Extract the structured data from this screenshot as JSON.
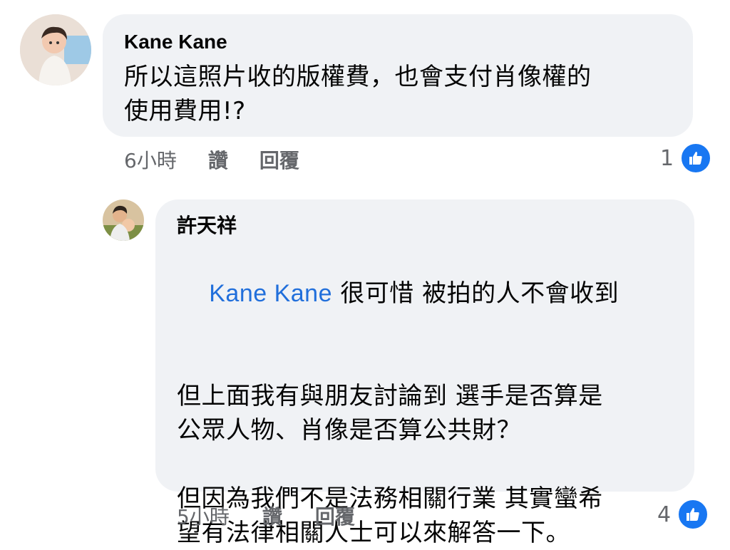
{
  "comments": [
    {
      "author": "Kane Kane",
      "text": "所以這照片收的版權費，也會支付肖像權的\n使用費用!?",
      "time": "6小時",
      "like_label": "讚",
      "reply_label": "回覆",
      "reaction_count": "1",
      "reaction_icon": "thumbs-up-icon"
    }
  ],
  "reply": {
    "author": "許天祥",
    "mention": "Kane Kane",
    "line1_rest": " 很可惜 被拍的人不會收到",
    "paragraph2": "但上面我有與朋友討論到 選手是否算是\n公眾人物、肖像是否算公共財？",
    "paragraph3": "但因為我們不是法務相關行業 其實蠻希\n望有法律相關人士可以來解答一下。",
    "time": "5小時",
    "like_label": "讚",
    "reply_label": "回覆",
    "reaction_count": "4",
    "reaction_icon": "thumbs-up-icon"
  },
  "colors": {
    "bubble": "#f0f2f5",
    "mention": "#216fdb",
    "like_blue": "#1877f2",
    "meta_gray": "#65676b"
  }
}
